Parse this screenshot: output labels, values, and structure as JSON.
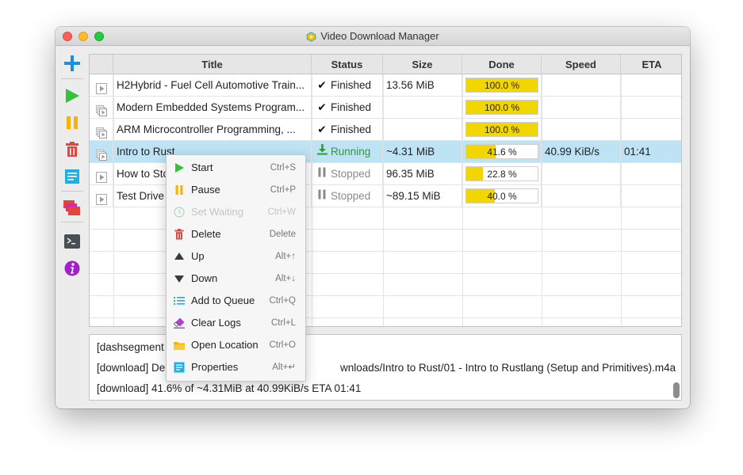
{
  "window": {
    "title": "Video Download Manager"
  },
  "table": {
    "headers": [
      "Title",
      "Status",
      "Size",
      "Done",
      "Speed",
      "ETA"
    ],
    "rows": [
      {
        "title": "H2Hybrid - Fuel Cell Automotive Training",
        "title_display": "H2Hybrid - Fuel Cell Automotive Train...",
        "status": "Finished",
        "status_icon": "check-icon",
        "size": "13.56 MiB",
        "done": "100.0 %",
        "progress": 1.0,
        "speed": "",
        "eta": "",
        "icon": "play-icon"
      },
      {
        "title": "Modern Embedded Systems Programming",
        "title_display": "Modern Embedded Systems Program...",
        "status": "Finished",
        "status_icon": "check-icon",
        "size": "",
        "done": "100.0 %",
        "progress": 1.0,
        "speed": "",
        "eta": "",
        "icon": "playlist-icon"
      },
      {
        "title": "ARM Microcontroller Programming",
        "title_display": "ARM Microcontroller Programming, ...",
        "status": "Finished",
        "status_icon": "check-icon",
        "size": "",
        "done": "100.0 %",
        "progress": 1.0,
        "speed": "",
        "eta": "",
        "icon": "playlist-icon"
      },
      {
        "title": "Intro to Rust",
        "title_display": "Intro to Rust",
        "status": "Running",
        "status_icon": "download-icon",
        "size": "~4.31 MiB",
        "done": "41.6 %",
        "progress": 0.416,
        "speed": "40.99 KiB/s",
        "eta": "01:41",
        "icon": "playlist-icon",
        "selected": true
      },
      {
        "title": "How to Sto",
        "title_display": "How to Sto",
        "status": "Stopped",
        "status_icon": "pause-icon",
        "size": "96.35 MiB",
        "done": "22.8 %",
        "progress": 0.228,
        "speed": "",
        "eta": "",
        "icon": "play-icon"
      },
      {
        "title": "Test Drive",
        "title_display": "Test Drive",
        "status": "Stopped",
        "status_icon": "pause-icon",
        "size": "~89.15 MiB",
        "done": "40.0 %",
        "progress": 0.4,
        "speed": "",
        "eta": "",
        "icon": "play-icon"
      }
    ]
  },
  "log": {
    "lines": [
      "[dashsegment",
      "[download] De",
      "[download]  41.6% of ~4.31MiB at 40.99KiB/s ETA 01:41"
    ],
    "line2_tail": "wnloads/Intro to Rust/01 - Intro to Rustlang (Setup and Primitives).m4a"
  },
  "context_menu": {
    "items": [
      {
        "label": "Start",
        "shortcut": "Ctrl+S",
        "icon": "play-icon",
        "enabled": true
      },
      {
        "label": "Pause",
        "shortcut": "Ctrl+P",
        "icon": "pause-icon",
        "enabled": true
      },
      {
        "label": "Set Waiting",
        "shortcut": "Ctrl+W",
        "icon": "clock-icon",
        "enabled": false
      },
      {
        "label": "Delete",
        "shortcut": "Delete",
        "icon": "trash-icon",
        "enabled": true
      },
      {
        "label": "Up",
        "shortcut": "Alt+↑",
        "icon": "arrow-up-icon",
        "enabled": true
      },
      {
        "label": "Down",
        "shortcut": "Alt+↓",
        "icon": "arrow-down-icon",
        "enabled": true
      },
      {
        "label": "Add to Queue",
        "shortcut": "Ctrl+Q",
        "icon": "list-icon",
        "enabled": true
      },
      {
        "label": "Clear Logs",
        "shortcut": "Ctrl+L",
        "icon": "eraser-icon",
        "enabled": true
      },
      {
        "label": "Open Location",
        "shortcut": "Ctrl+O",
        "icon": "folder-icon",
        "enabled": true
      },
      {
        "label": "Properties",
        "shortcut": "Alt+↵",
        "icon": "properties-icon",
        "enabled": true
      }
    ]
  },
  "colors": {
    "progress_fill": "#f2d600",
    "selected_row": "#bde3f5",
    "running_status": "#2e9a3a",
    "stopped_status": "#8a8a8a"
  }
}
